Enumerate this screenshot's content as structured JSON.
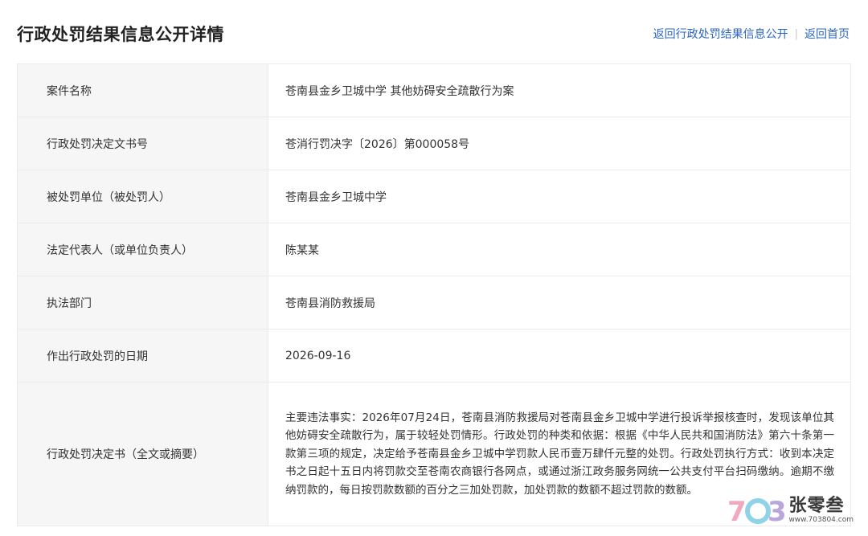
{
  "header": {
    "title": "行政处罚结果信息公开详情",
    "link_back_list": "返回行政处罚结果信息公开",
    "separator": "|",
    "link_home": "返回首页"
  },
  "rows": [
    {
      "label": "案件名称",
      "value": "苍南县金乡卫城中学 其他妨碍安全疏散行为案"
    },
    {
      "label": "行政处罚决定文书号",
      "value": "苍消行罚决字〔2026〕第000058号"
    },
    {
      "label": "被处罚单位（被处罚人）",
      "value": "苍南县金乡卫城中学"
    },
    {
      "label": "法定代表人（或单位负责人）",
      "value": "陈某某"
    },
    {
      "label": "执法部门",
      "value": "苍南县消防救援局"
    },
    {
      "label": "作出行政处罚的日期",
      "value": "2026-09-16"
    },
    {
      "label": "行政处罚决定书（全文或摘要）",
      "value": "主要违法事实：2026年07月24日，苍南县消防救援局对苍南县金乡卫城中学进行投诉举报核查时，发现该单位其他妨碍安全疏散行为，属于较轻处罚情形。行政处罚的种类和依据：根据《中华人民共和国消防法》第六十条第一款第三项的规定，决定给予苍南县金乡卫城中学罚款人民币壹万肆仟元整的处罚。行政处罚执行方式：收到本决定书之日起十五日内将罚款交至苍南农商银行各网点，或通过浙江政务服务网统一公共支付平台扫码缴纳。逾期不缴纳罚款的，每日按罚款数额的百分之三加处罚款，加处罚款的数额不超过罚款的数额。"
    }
  ],
  "watermark": {
    "logo_text": "703",
    "name": "张零叁",
    "url": "www.703804.com"
  },
  "colors": {
    "link": "#2b65c7",
    "label_bg": "#f6f6f6",
    "border": "#ebebeb"
  }
}
